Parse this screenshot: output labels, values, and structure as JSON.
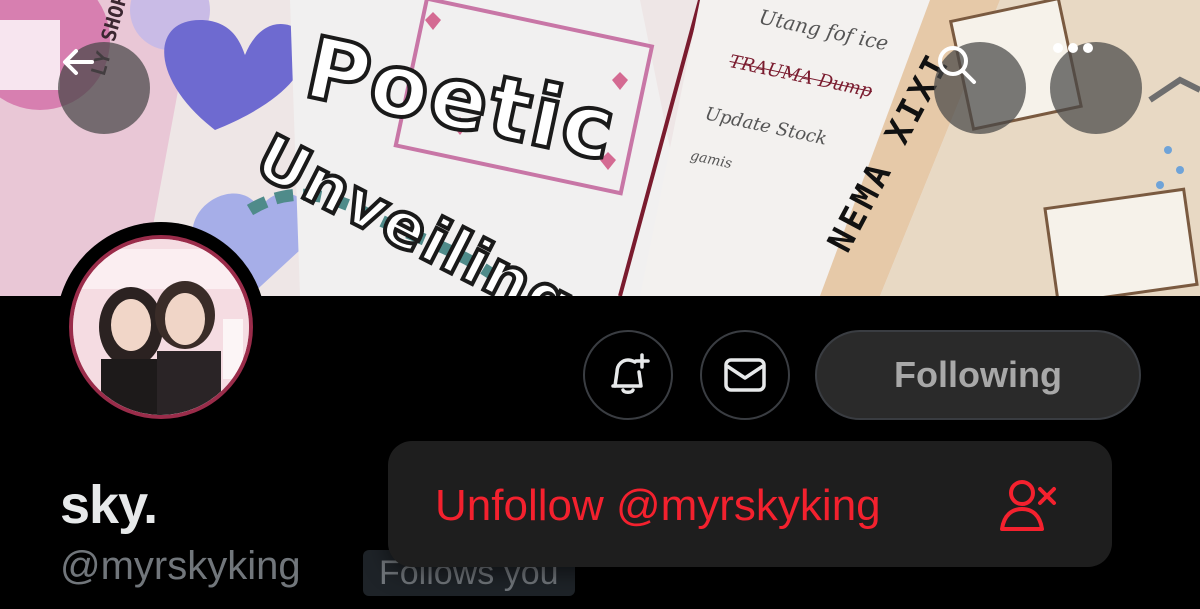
{
  "header": {
    "banner_texts": {
      "title_line1": "Poetic",
      "title_line2": "Unveiling",
      "todo_1": "Utang fof ice",
      "todo_2": "TRAUMA Dump",
      "todo_3": "Update Stock",
      "todo_4": "gamis",
      "shop": "LY SHOP",
      "cinema": "NEMA XIXI"
    },
    "back_icon": "arrow-left-icon",
    "search_icon": "search-icon",
    "more_icon": "more-horizontal-icon"
  },
  "profile": {
    "display_name": "sky.",
    "handle": "@myrskyking",
    "follows_you": "Follows you"
  },
  "actions": {
    "notify_icon": "bell-plus-icon",
    "message_icon": "envelope-icon",
    "following_label": "Following"
  },
  "popup": {
    "unfollow_label": "Unfollow @myrskyking",
    "unfollow_icon": "user-remove-icon",
    "danger_color": "#f4212e"
  },
  "colors": {
    "background": "#000000",
    "text_primary": "#e7e9ea",
    "text_secondary": "#71767b"
  }
}
